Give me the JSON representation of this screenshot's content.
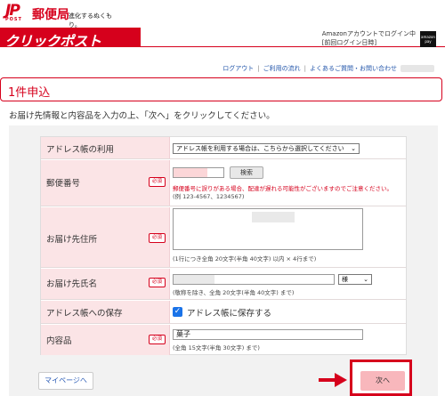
{
  "header": {
    "jp_mark": "JP",
    "post_mark": "POST",
    "org": "郵便局",
    "tagline": "進化するぬくもり。",
    "brand": "クリックポスト",
    "account_line1": "Amazonアカウントでログイン中",
    "account_line2": "[前回ログイン日時]",
    "amazon_badge": "amazon pay"
  },
  "toplinks": {
    "logout": "ログアウト",
    "guide": "ご利用の流れ",
    "faq": "よくあるご質問・お問い合わせ"
  },
  "page_title": "1件申込",
  "intro": "お届け先情報と内容品を入力の上、「次へ」をクリックしてください。",
  "form": {
    "required_label": "必須",
    "address_book": {
      "label": "アドレス帳の利用",
      "select_value": "アドレス帳を利用する場合は、こちらから選択してください"
    },
    "postal": {
      "label": "郵便番号",
      "search_button": "検索",
      "warning": "郵便番号に誤りがある場合、配達が遅れる可能性がございますのでご注意ください。",
      "example": "(例 123-4567、1234567)"
    },
    "address": {
      "label": "お届け先住所",
      "note": "(1行につき全角 20文字(半角 40文字) 以内 × 4行まで)"
    },
    "name": {
      "label": "お届け先氏名",
      "honorific": "様",
      "note": "(敬称を除き、全角 20文字(半角 40文字) まで)"
    },
    "save": {
      "label": "アドレス帳への保存",
      "checkbox_label": "アドレス帳に保存する",
      "checked": true
    },
    "contents": {
      "label": "内容品",
      "value": "菓子",
      "note": "(全角 15文字(半角 30文字) まで)"
    }
  },
  "buttons": {
    "mypage": "マイページへ",
    "next": "次へ"
  },
  "colors": {
    "brand_red": "#d6001c",
    "label_bg": "#fbe4e6",
    "next_bg": "#f8b7bc",
    "link_blue": "#2255aa"
  }
}
